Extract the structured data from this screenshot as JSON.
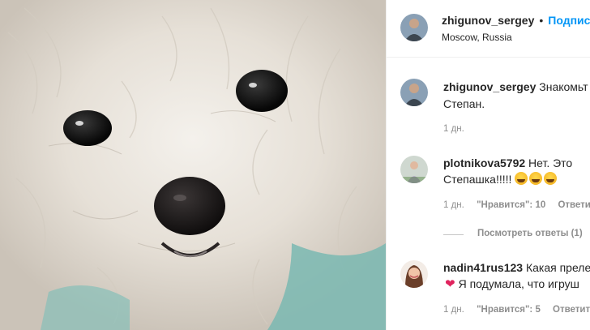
{
  "post": {
    "image_subject": "dog-photo",
    "author": {
      "username": "zhigunov_sergey",
      "location": "Moscow, Russia",
      "follow_label": "Подписа"
    },
    "separator": "•"
  },
  "comments": [
    {
      "username": "zhigunov_sergey",
      "text_line1": "Знакомьт",
      "text_line2": "Степан.",
      "time": "1 дн."
    },
    {
      "username": "plotnikova5792",
      "text_line1": "Нет. Это",
      "text_line2": "Степашка!!!!!",
      "emoji": [
        "joy-emoji",
        "joy-emoji",
        "joy-emoji"
      ],
      "time": "1 дн.",
      "likes": "\"Нравится\": 10",
      "reply": "Ответить",
      "view_replies": "Посмотреть ответы (1)"
    },
    {
      "username": "nadin41rus123",
      "text_line1": "Какая преле",
      "text_line2": "Я подумала, что игруш",
      "emoji_start": "heart-icon",
      "time": "1 дн.",
      "likes": "\"Нравится\": 5",
      "reply": "Ответить"
    }
  ],
  "colors": {
    "follow": "#0095f6",
    "text": "#262626",
    "meta": "#8e8e8e",
    "border": "#efefef"
  }
}
